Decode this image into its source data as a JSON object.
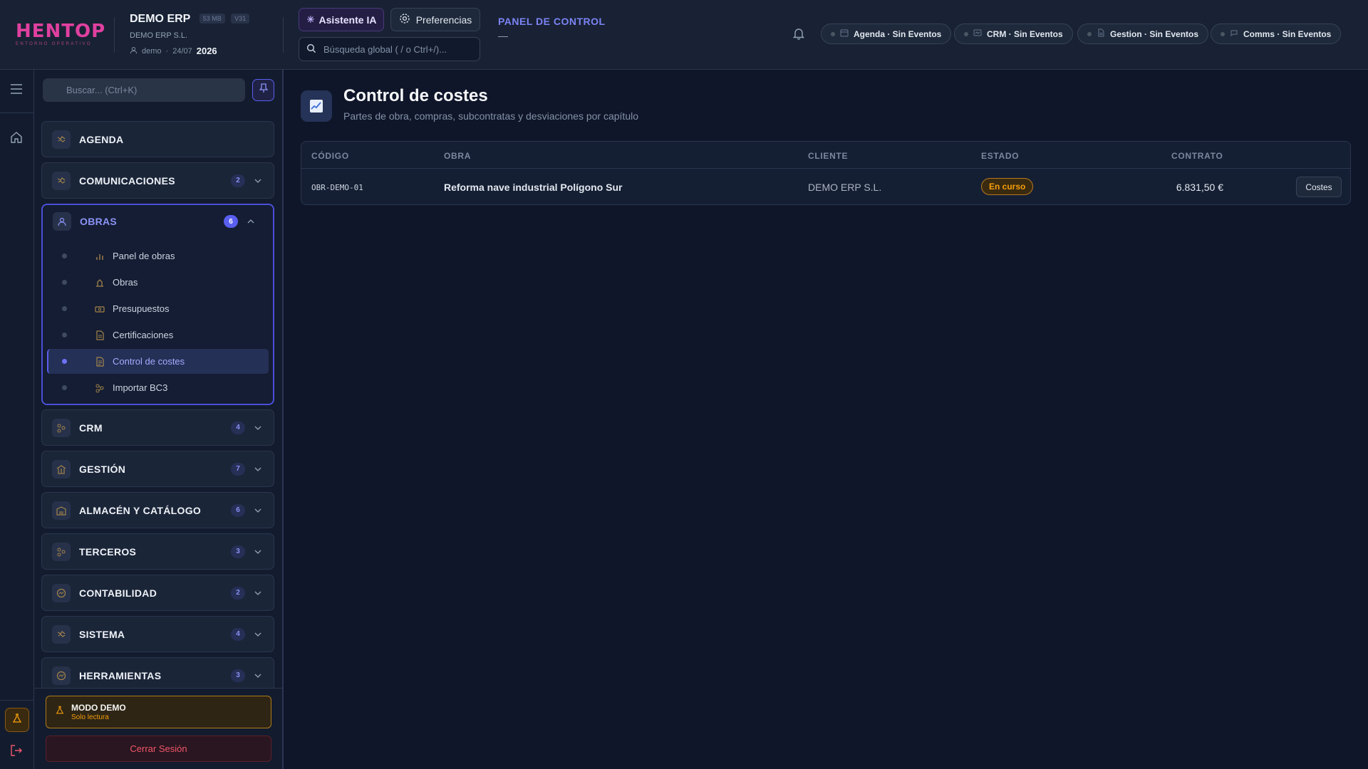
{
  "header": {
    "logo": "HENTOP",
    "logo_tagline": "ENTORNO OPERATIVO",
    "company_name": "DEMO ERP",
    "size_chip": "53 MB",
    "version_chip": "V31",
    "company_legal": "DEMO ERP S.L.",
    "user": "demo",
    "date": "24/07",
    "year": "2026",
    "ai_button": "Asistente IA",
    "prefs_button": "Preferencias",
    "search_placeholder": "Búsqueda global ( / o Ctrl+/)...",
    "panel_title": "PANEL DE CONTROL",
    "panel_dash": "—",
    "pills": [
      {
        "label": "Agenda · Sin Eventos",
        "icon": "calendar-icon"
      },
      {
        "label": "CRM · Sin Eventos",
        "icon": "crm-icon"
      },
      {
        "label": "Gestion · Sin Eventos",
        "icon": "document-icon"
      },
      {
        "label": "Comms · Sin Eventos",
        "icon": "chat-icon"
      }
    ]
  },
  "sidebar": {
    "search_placeholder": "Buscar... (Ctrl+K)",
    "categories": [
      {
        "label": "AGENDA",
        "count": ""
      },
      {
        "label": "COMUNICACIONES",
        "count": "2"
      },
      {
        "label": "OBRAS",
        "count": "6"
      },
      {
        "label": "CRM",
        "count": "4"
      },
      {
        "label": "GESTIÓN",
        "count": "7"
      },
      {
        "label": "ALMACÉN Y CATÁLOGO",
        "count": "6"
      },
      {
        "label": "TERCEROS",
        "count": "3"
      },
      {
        "label": "CONTABILIDAD",
        "count": "2"
      },
      {
        "label": "SISTEMA",
        "count": "4"
      },
      {
        "label": "HERRAMIENTAS",
        "count": "3"
      }
    ],
    "obras_items": [
      {
        "label": "Panel de obras"
      },
      {
        "label": "Obras"
      },
      {
        "label": "Presupuestos"
      },
      {
        "label": "Certificaciones"
      },
      {
        "label": "Control de costes",
        "active": true
      },
      {
        "label": "Importar BC3"
      }
    ],
    "demo_title": "MODO DEMO",
    "demo_sub": "Solo lectura",
    "logout": "Cerrar Sesión"
  },
  "main": {
    "title": "Control de costes",
    "subtitle": "Partes de obra, compras, subcontratas y desviaciones por capítulo",
    "columns": [
      "CÓDIGO",
      "OBRA",
      "CLIENTE",
      "ESTADO",
      "CONTRATO"
    ],
    "rows": [
      {
        "codigo": "OBR-DEMO-01",
        "obra": "Reforma nave industrial Polígono Sur",
        "cliente": "DEMO ERP S.L.",
        "estado": "En curso",
        "contrato": "6.831,50 €",
        "action": "Costes"
      }
    ]
  },
  "colors": {
    "accent": "#5b5ef0",
    "brand": "#e040a0",
    "warning": "#f59e0b",
    "danger": "#f0566a",
    "background": "#0f1629"
  }
}
